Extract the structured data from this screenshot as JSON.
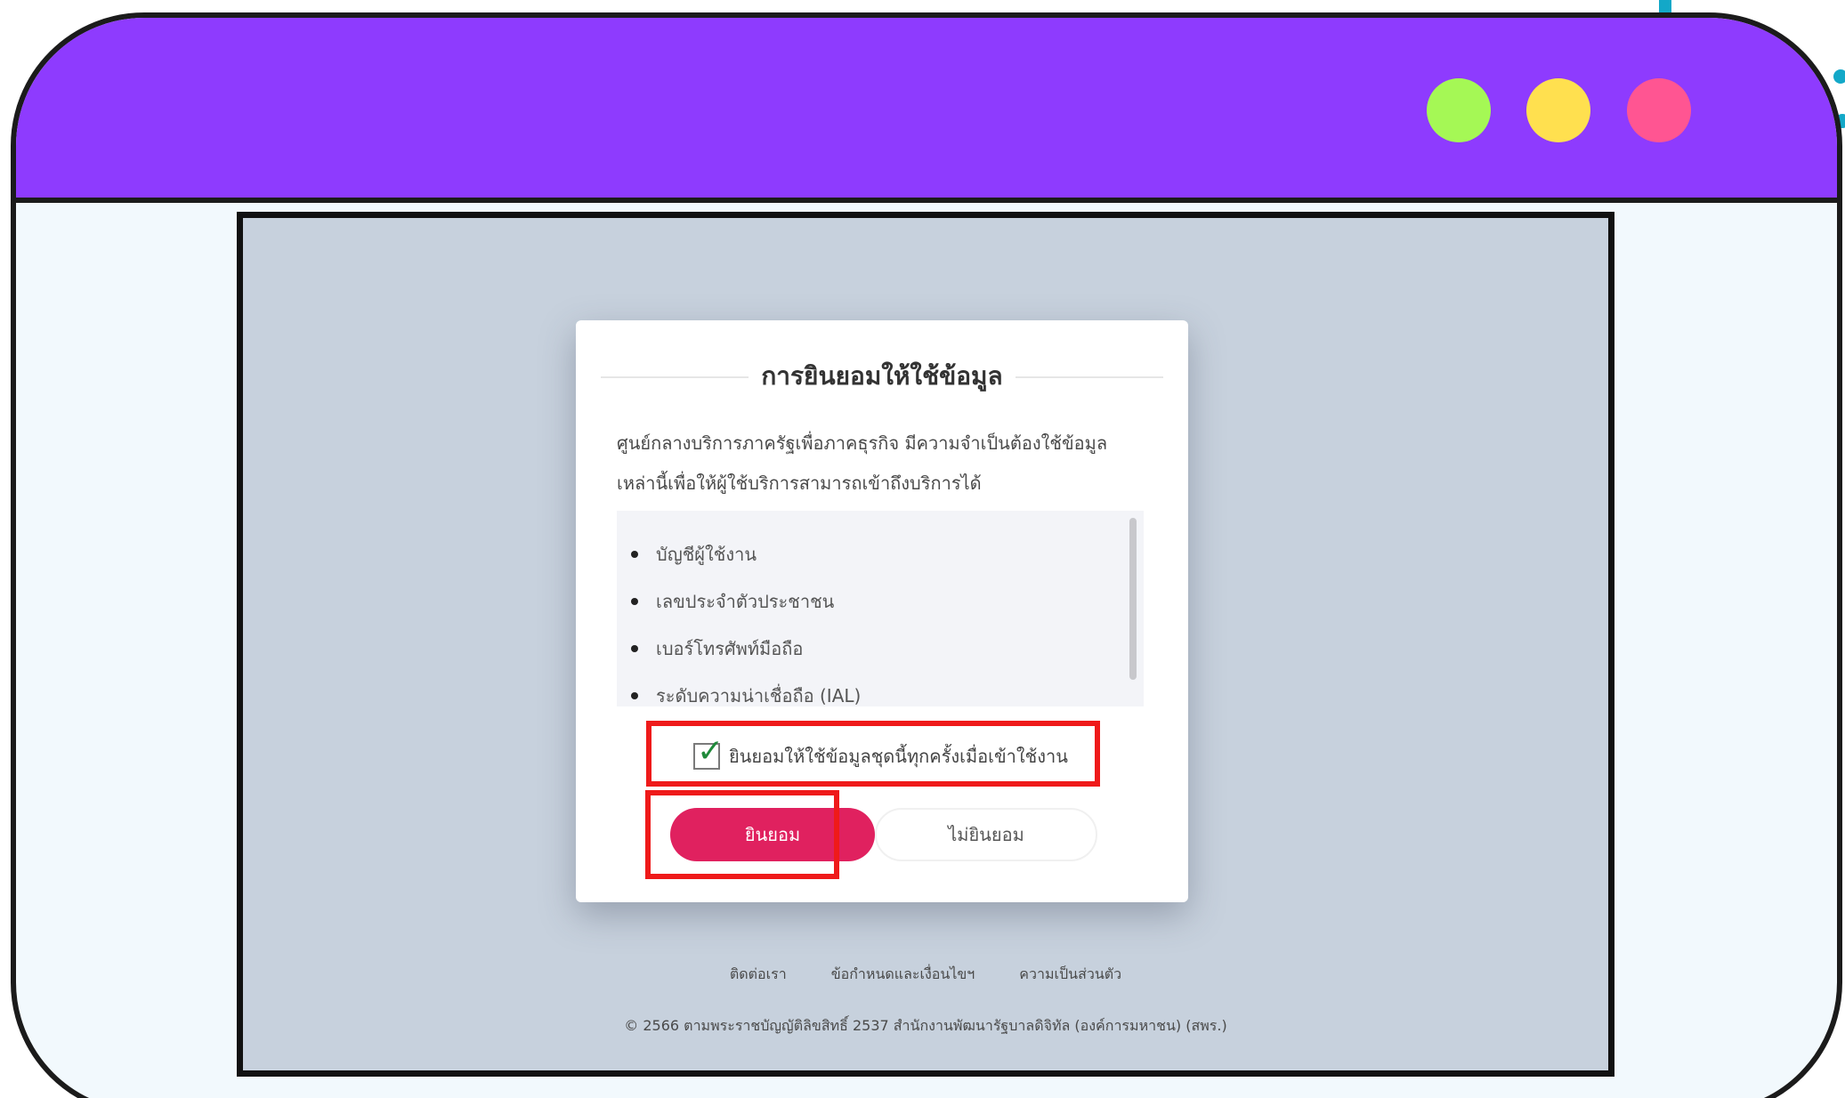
{
  "window": {
    "controls": [
      {
        "name": "green-dot",
        "color": "#a5f855"
      },
      {
        "name": "yellow-dot",
        "color": "#ffe04f"
      },
      {
        "name": "pink-dot",
        "color": "#ff5592"
      }
    ],
    "titlebar_color": "#8e3bfe"
  },
  "dialog": {
    "title": "การยินยอมให้ใช้ข้อมูล",
    "description_line1": "ศูนย์กลางบริการภาครัฐเพื่อภาคธุรกิจ มีความจำเป็นต้องใช้ข้อมูล",
    "description_line2": "เหล่านี้เพื่อให้ผู้ใช้บริการสามารถเข้าถึงบริการได้",
    "permissions": [
      "บัญชีผู้ใช้งาน",
      "เลขประจำตัวประชาชน",
      "เบอร์โทรศัพท์มือถือ",
      "ระดับความน่าเชื่อถือ (IAL)"
    ],
    "consent_checkbox_label": "ยินยอมให้ใช้ข้อมูลชุดนี้ทุกครั้งเมื่อเข้าใช้งาน",
    "consent_checked": true,
    "accept_label": "ยินยอม",
    "decline_label": "ไม่ยินยอม",
    "accent_color": "#e0215f"
  },
  "footer": {
    "links": [
      "ติดต่อเรา",
      "ข้อกำหนดและเงื่อนไขฯ",
      "ความเป็นส่วนตัว"
    ],
    "copyright": "© 2566 ตามพระราชบัญญัติลิขสิทธิ์ 2537 สำนักงานพัฒนารัฐบาลดิจิทัล (องค์การมหาชน) (สพร.)"
  },
  "highlight_color": "#ef1a1a"
}
